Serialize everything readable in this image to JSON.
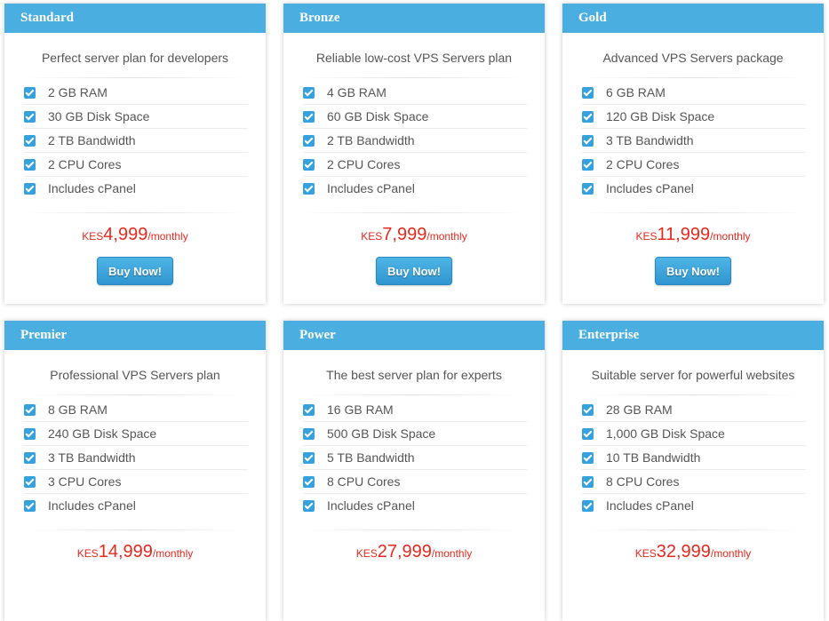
{
  "colors": {
    "header": "#4aaee0",
    "check": "#36a1dd",
    "price": "#e8281e",
    "button": "#3aa3dc"
  },
  "plans": [
    {
      "name": "Standard",
      "description": "Perfect server plan for developers",
      "features": [
        "2 GB RAM",
        "30 GB Disk Space",
        "2 TB Bandwidth",
        "2 CPU Cores",
        "Includes cPanel"
      ],
      "currency": "KES",
      "price": "4,999",
      "period": "/monthly",
      "button": "Buy Now!"
    },
    {
      "name": "Bronze",
      "description": "Reliable low-cost VPS Servers plan",
      "features": [
        "4 GB RAM",
        "60 GB Disk Space",
        "2 TB Bandwidth",
        "2 CPU Cores",
        "Includes cPanel"
      ],
      "currency": "KES",
      "price": "7,999",
      "period": "/monthly",
      "button": "Buy Now!"
    },
    {
      "name": "Gold",
      "description": "Advanced VPS Servers package",
      "features": [
        "6 GB RAM",
        "120 GB Disk Space",
        "3 TB Bandwidth",
        "2 CPU Cores",
        "Includes cPanel"
      ],
      "currency": "KES",
      "price": "11,999",
      "period": "/monthly",
      "button": "Buy Now!"
    },
    {
      "name": "Premier",
      "description": "Professional VPS Servers plan",
      "features": [
        "8 GB RAM",
        "240 GB Disk Space",
        "3 TB Bandwidth",
        "3 CPU Cores",
        "Includes cPanel"
      ],
      "currency": "KES",
      "price": "14,999",
      "period": "/monthly"
    },
    {
      "name": "Power",
      "description": "The best server plan for experts",
      "features": [
        "16 GB RAM",
        "500 GB Disk Space",
        "5 TB Bandwidth",
        "8 CPU Cores",
        "Includes cPanel"
      ],
      "currency": "KES",
      "price": "27,999",
      "period": "/monthly"
    },
    {
      "name": "Enterprise",
      "description": "Suitable server for powerful websites",
      "features": [
        "28 GB RAM",
        "1,000 GB Disk Space",
        "10 TB Bandwidth",
        "8 CPU Cores",
        "Includes cPanel"
      ],
      "currency": "KES",
      "price": "32,999",
      "period": "/monthly"
    }
  ]
}
